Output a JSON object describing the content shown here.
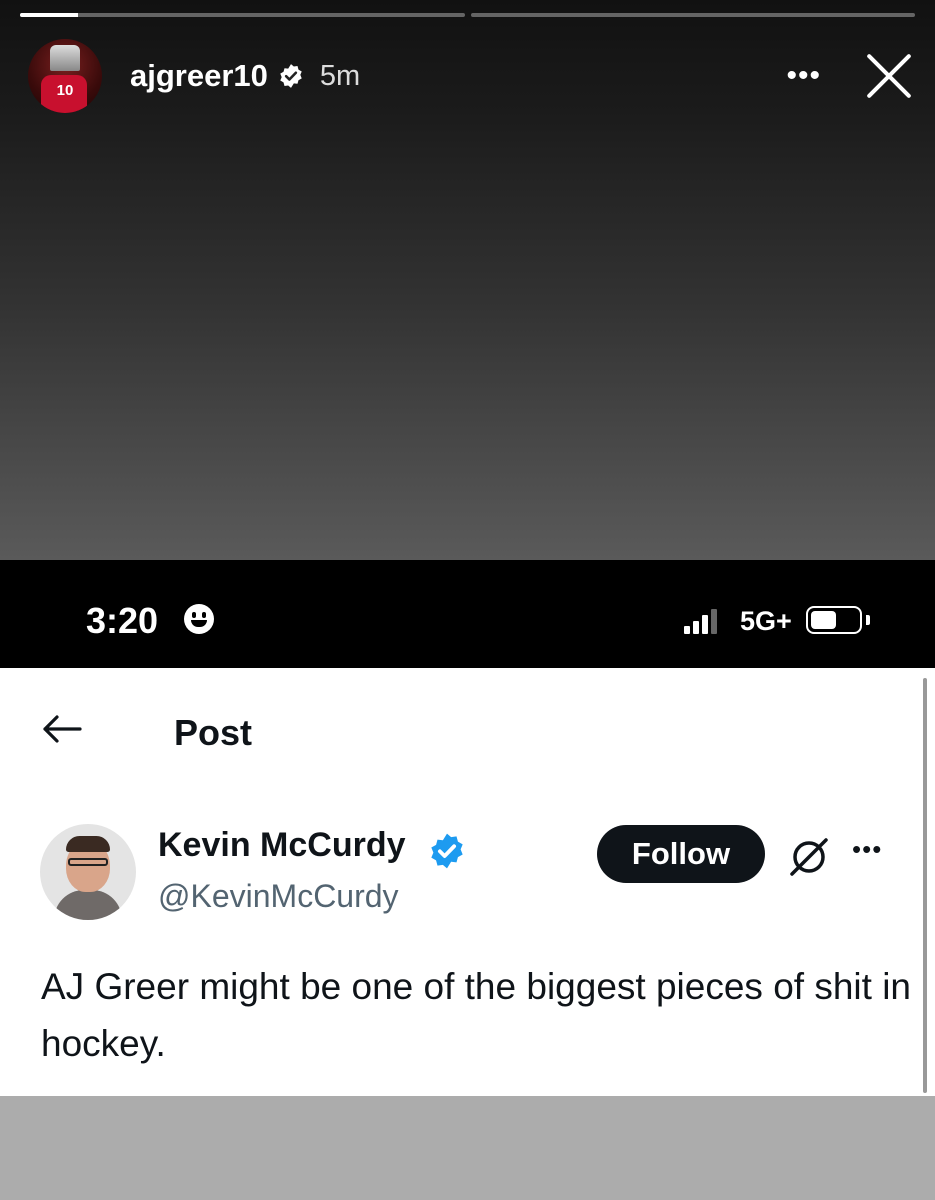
{
  "story": {
    "username": "ajgreer10",
    "time": "5m",
    "avatar_number": "10",
    "more_label": "•••",
    "progress": [
      0.13,
      0.0
    ]
  },
  "status_bar": {
    "time": "3:20",
    "network": "5G+",
    "battery_level": 0.6
  },
  "post": {
    "header_title": "Post",
    "author_name": "Kevin McCurdy",
    "author_handle": "@KevinMcCurdy",
    "follow_label": "Follow",
    "more_label": "•••",
    "text": "AJ Greer might be one of the biggest pieces of shit in hockey."
  },
  "colors": {
    "verified_blue": "#1d9bf0",
    "follow_bg": "#0f1419",
    "handle_gray": "#536471"
  },
  "icons": [
    "verified-badge-icon",
    "more-dots-icon",
    "close-icon",
    "smiley-icon",
    "signal-icon",
    "battery-icon",
    "back-arrow-icon",
    "grok-icon"
  ]
}
